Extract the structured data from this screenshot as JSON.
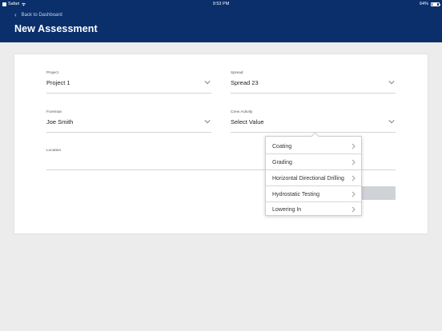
{
  "status": {
    "carrier": "Safari",
    "time": "9:53 PM",
    "battery": "64%"
  },
  "header": {
    "back_label": "Back to Dashboard",
    "title": "New Assessment"
  },
  "form": {
    "project": {
      "label": "Project",
      "value": "Project 1"
    },
    "spread": {
      "label": "Spread",
      "value": "Spread 23"
    },
    "foreman": {
      "label": "Foreman",
      "value": "Joe Smith"
    },
    "crew_activity": {
      "label": "Crew Activity",
      "value": "Select Value"
    },
    "location": {
      "label": "Location",
      "value": ""
    }
  },
  "dropdown": {
    "items": [
      "Coating",
      "Grading",
      "Horizontal Directional Drilling",
      "Hydrostatic Testing",
      "Lowering In"
    ]
  },
  "colors": {
    "header_bg": "#0a2f6b",
    "page_bg": "#ececec",
    "card_bg": "#ffffff",
    "button_disabled": "#cfd3d8"
  }
}
